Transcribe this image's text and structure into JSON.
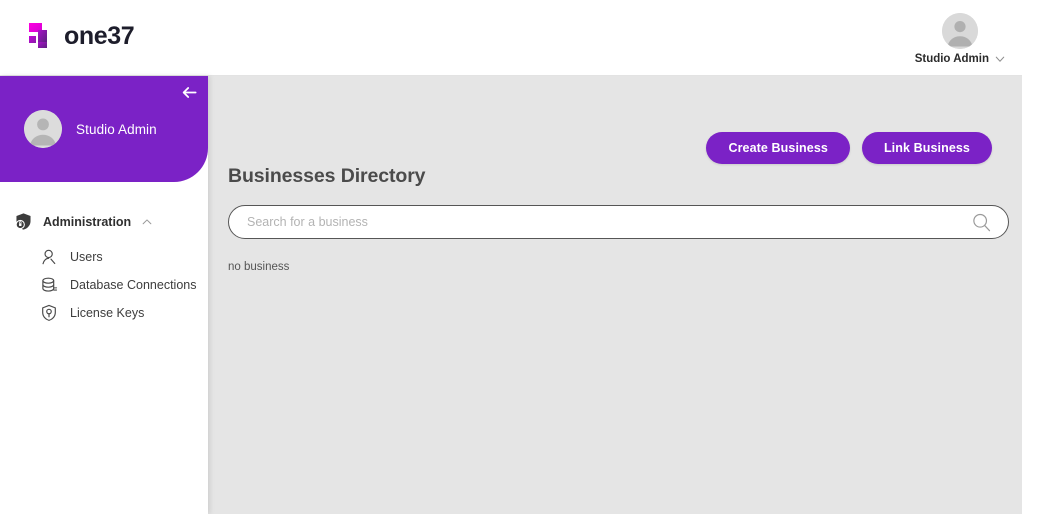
{
  "brand": {
    "name": "one37",
    "logo_icon": "one37-logo-icon",
    "colors": {
      "magenta": "#e800e8",
      "purple": "#7b22c6",
      "dark": "#1d1d2b"
    }
  },
  "topbar": {
    "user": {
      "name": "Studio Admin",
      "avatar_icon": "user-avatar-icon",
      "chevron_icon": "chevron-down-icon"
    }
  },
  "sidebar": {
    "user": {
      "name": "Studio Admin",
      "avatar_icon": "user-avatar-icon"
    },
    "collapse_icon": "arrow-left-icon",
    "groups": [
      {
        "label": "Administration",
        "icon": "shield-lock-icon",
        "caret_icon": "chevron-up-icon",
        "expanded": true,
        "items": [
          {
            "label": "Users",
            "icon": "user-search-icon"
          },
          {
            "label": "Database Connections",
            "icon": "database-icon"
          },
          {
            "label": "License Keys",
            "icon": "shield-key-icon"
          }
        ]
      }
    ]
  },
  "main": {
    "title": "Businesses Directory",
    "actions": [
      {
        "label": "Create Business",
        "name": "create-business-button"
      },
      {
        "label": "Link Business",
        "name": "link-business-button"
      }
    ],
    "search": {
      "placeholder": "Search for a business",
      "value": "",
      "icon": "search-icon"
    },
    "empty_message": "no business"
  },
  "theme": {
    "accent": "#7b22c6",
    "content_background": "#e5e5e5",
    "panel_background": "#ffffff"
  }
}
